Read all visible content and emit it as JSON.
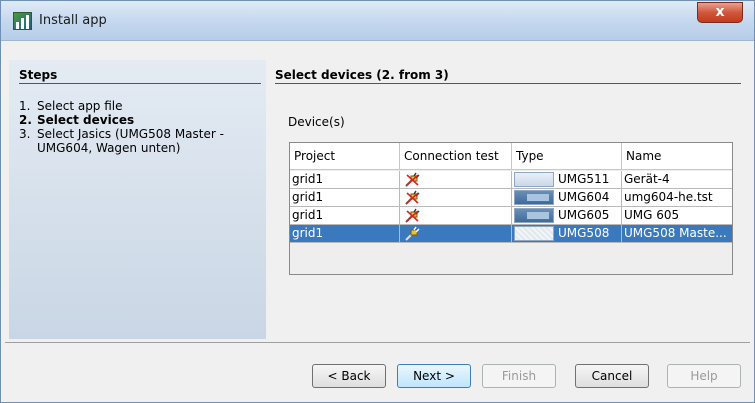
{
  "window": {
    "title": "Install app",
    "close_label": "x"
  },
  "steps": {
    "title": "Steps",
    "items": [
      {
        "num": "1.",
        "label": "Select app file"
      },
      {
        "num": "2.",
        "label": "Select devices"
      },
      {
        "num": "3.",
        "label": "Select Jasics (UMG508 Master - UMG604, Wagen unten)"
      }
    ],
    "active_index": 1
  },
  "main": {
    "title": "Select devices (2. from 3)",
    "devices_label": "Device(s)",
    "columns": [
      "Project",
      "Connection test",
      "Type",
      "Name"
    ],
    "rows": [
      {
        "project": "grid1",
        "type": "UMG511",
        "name": "Gerät-4",
        "selected": false
      },
      {
        "project": "grid1",
        "type": "UMG604",
        "name": "umg604-he.tst",
        "selected": false
      },
      {
        "project": "grid1",
        "type": "UMG605",
        "name": "UMG 605",
        "selected": false
      },
      {
        "project": "grid1",
        "type": "UMG508",
        "name": "UMG508 Maste...",
        "selected": true
      }
    ]
  },
  "buttons": {
    "back": "< Back",
    "next": "Next >",
    "finish": "Finish",
    "cancel": "Cancel",
    "help": "Help"
  },
  "colors": {
    "selection": "#3a79bd",
    "title_bar": "#c3d7ee",
    "close": "#c23b1c"
  },
  "icons": {
    "connection": "disconnected-plug-icon",
    "app": "app-icon"
  }
}
